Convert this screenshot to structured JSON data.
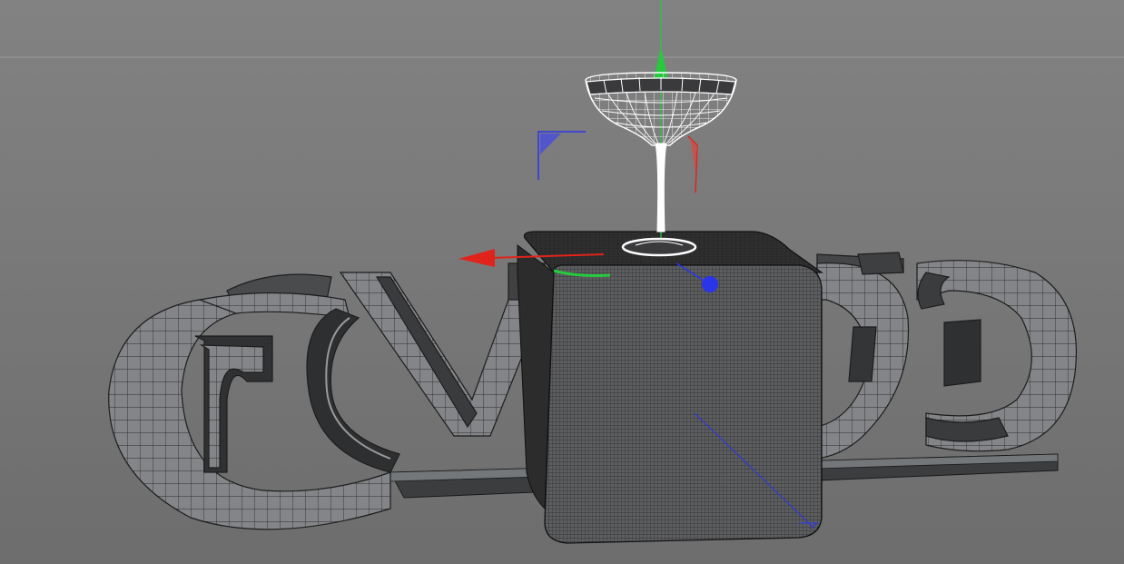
{
  "viewport": {
    "background_top": "#828282",
    "background_bottom": "#6d6d6d",
    "horizon_line_color": "#9a9a9a"
  },
  "scene": {
    "objects": [
      {
        "name": "text-extrusion",
        "kind": "wireframe-mesh",
        "color": "#7d7f82"
      },
      {
        "name": "cube",
        "kind": "subdivided-cube",
        "color": "#5a5b5d"
      },
      {
        "name": "coupe-glass",
        "kind": "wireframe-mesh",
        "color": "#ffffff"
      }
    ]
  },
  "gizmo": {
    "x_axis_color": "#e0241b",
    "y_axis_color": "#27c93f",
    "z_axis_color": "#2a35e8",
    "icons": [
      "move-gizmo-icon",
      "rotation-handle-icon"
    ]
  }
}
